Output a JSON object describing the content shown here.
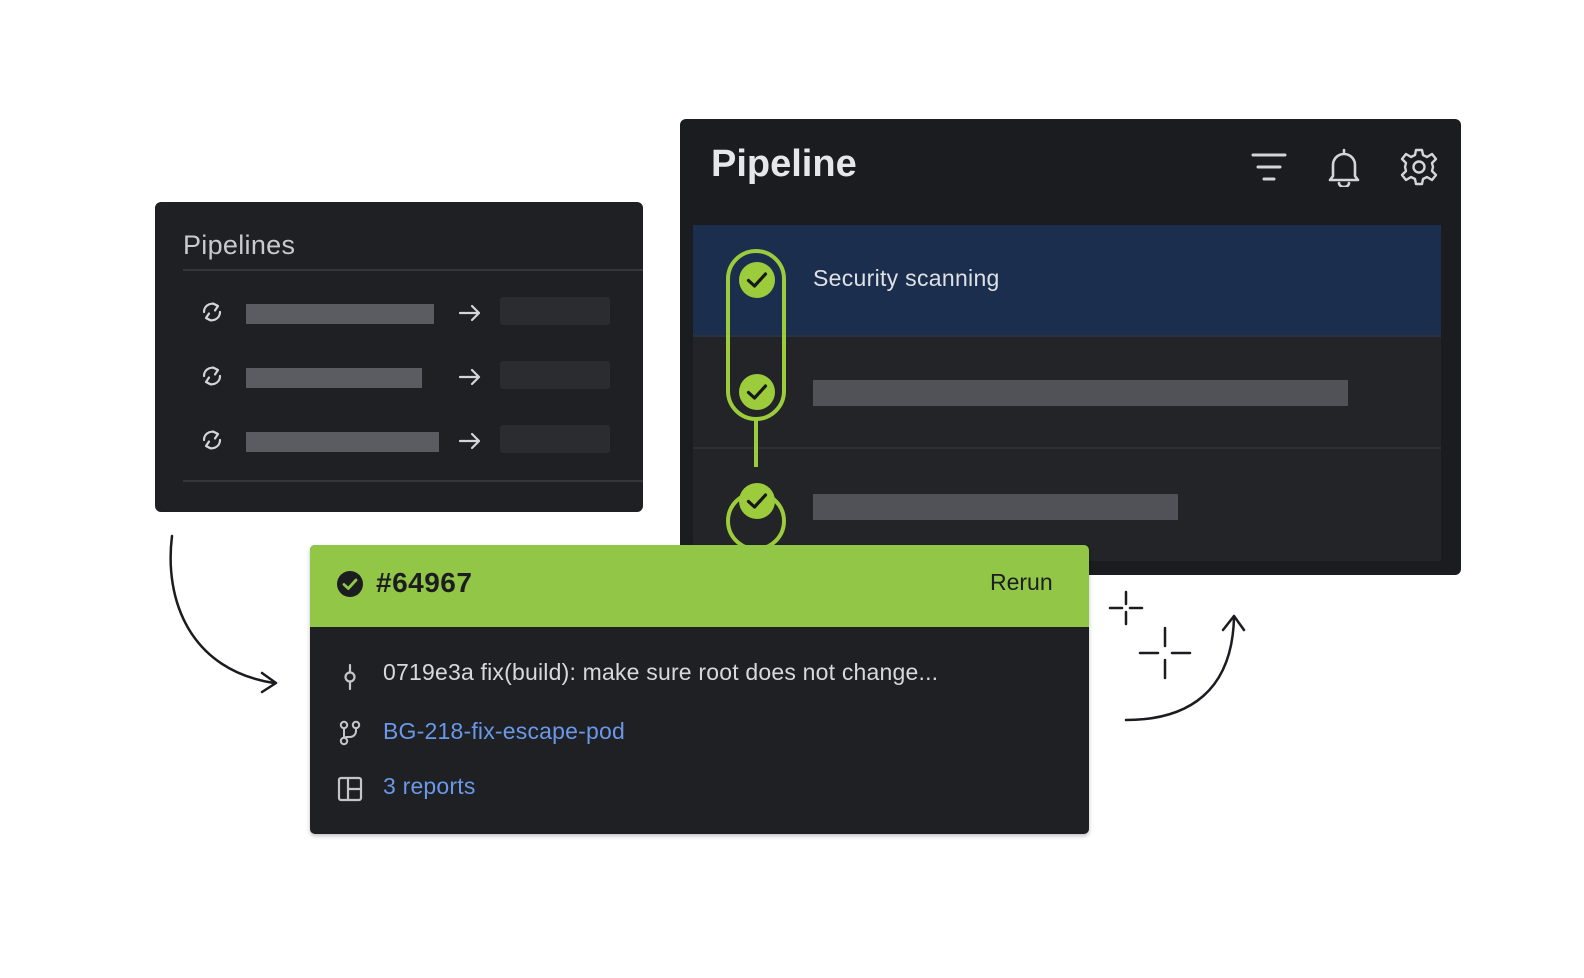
{
  "pipelines_panel": {
    "title": "Pipelines",
    "rows": [
      {
        "icon": "sync-icon"
      },
      {
        "icon": "sync-icon"
      },
      {
        "icon": "sync-icon"
      }
    ]
  },
  "pipeline_panel": {
    "title": "Pipeline",
    "header_icons": [
      "filter-icon",
      "bell-icon",
      "gear-icon"
    ],
    "stages": [
      {
        "label": "Security scanning",
        "status": "success",
        "selected": true
      },
      {
        "label": "",
        "status": "success"
      },
      {
        "label": "",
        "status": "success"
      }
    ]
  },
  "job_card": {
    "id": "#64967",
    "status": "success",
    "rerun_label": "Rerun",
    "commit": "0719e3a fix(build): make sure root does not change...",
    "branch": "BG-218-fix-escape-pod",
    "reports": "3 reports"
  },
  "colors": {
    "accent_green": "#92c647",
    "stage_green": "#9ccc3c",
    "link_blue": "#6a98e8",
    "panel_dark": "#1f2023",
    "selected_row": "#1c2e4d"
  }
}
